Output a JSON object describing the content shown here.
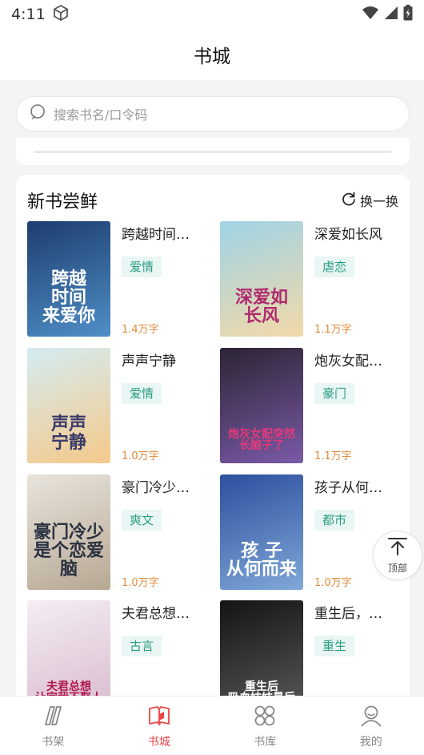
{
  "status_bar": {
    "time": "4:11"
  },
  "header": {
    "title": "书城"
  },
  "search": {
    "placeholder": "搜索书名/口令码"
  },
  "section": {
    "title": "新书尝鲜",
    "refresh_label": "换一换",
    "books": [
      {
        "title": "跨越时间…",
        "tag": "爱情",
        "words": "1.4万字",
        "cover_text": "跨越\n时间\n来爱你",
        "colors": {
          "bg1": "#1d3d6e",
          "bg2": "#4f8fc7",
          "text": "#ffffff"
        }
      },
      {
        "title": "深爱如长风",
        "tag": "虐恋",
        "words": "1.1万字",
        "cover_text": "深爱如\n长风",
        "colors": {
          "bg1": "#9fd3e6",
          "bg2": "#f3d9a8",
          "text": "#b02a6e"
        }
      },
      {
        "title": "声声宁静",
        "tag": "爱情",
        "words": "1.0万字",
        "cover_text": "声声\n宁静",
        "colors": {
          "bg1": "#d4ecf2",
          "bg2": "#f5c98a",
          "text": "#3a3a6a"
        }
      },
      {
        "title": "炮灰女配…",
        "tag": "豪门",
        "words": "1.1万字",
        "cover_text": "炮灰女配突然\n长脑子了",
        "colors": {
          "bg1": "#2c2433",
          "bg2": "#7a5aa8",
          "text": "#e03a7a"
        }
      },
      {
        "title": "豪门冷少…",
        "tag": "爽文",
        "words": "1.0万字",
        "cover_text": "豪门冷少\n是个恋爱脑",
        "colors": {
          "bg1": "#e8e4dc",
          "bg2": "#b7a893",
          "text": "#2a3040"
        }
      },
      {
        "title": "孩子从何…",
        "tag": "都市",
        "words": "1.0万字",
        "cover_text": "孩 子\n从何而来",
        "colors": {
          "bg1": "#2d4f9e",
          "bg2": "#7fa8d8",
          "text": "#ffffff"
        }
      },
      {
        "title": "夫君总想…",
        "tag": "古言",
        "words": "",
        "cover_text": "夫君总想\n让完我不娶人",
        "colors": {
          "bg1": "#f4eef2",
          "bg2": "#d8b9cf",
          "text": "#b0184e"
        }
      },
      {
        "title": "重生后，…",
        "tag": "重生",
        "words": "",
        "cover_text": "重生后\n吸血妹妹最后",
        "colors": {
          "bg1": "#141414",
          "bg2": "#5a5a5a",
          "text": "#ffffff"
        }
      }
    ]
  },
  "back_to_top": {
    "label": "顶部"
  },
  "tabbar": {
    "items": [
      {
        "label": "书架",
        "icon": "bookshelf-icon",
        "active": false
      },
      {
        "label": "书城",
        "icon": "book-open-icon",
        "active": true
      },
      {
        "label": "书库",
        "icon": "grid-circles-icon",
        "active": false
      },
      {
        "label": "我的",
        "icon": "user-icon",
        "active": false
      }
    ]
  },
  "accent_color": "#e8484a",
  "tag_color": "#2a9d86"
}
